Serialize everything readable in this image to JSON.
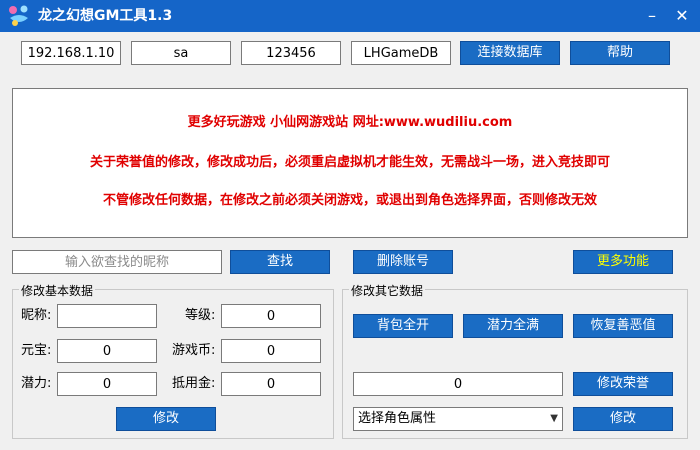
{
  "window": {
    "title": "龙之幻想GM工具1.3",
    "minimize": "–",
    "close": "✕"
  },
  "connection": {
    "ip": "192.168.1.10",
    "user": "sa",
    "password": "123456",
    "database": "LHGameDB",
    "connect_label": "连接数据库",
    "help_label": "帮助"
  },
  "notice": {
    "line1": "更多好玩游戏 小仙网游戏站 网址:www.wudiliu.com",
    "line2": "关于荣誉值的修改，修改成功后，必须重启虚拟机才能生效，无需战斗一场，进入竞技即可",
    "line3": "不管修改任何数据，在修改之前必须关闭游戏，或退出到角色选择界面，否则修改无效"
  },
  "search": {
    "placeholder": "输入欲查找的昵称",
    "search_label": "查找",
    "delete_label": "删除账号",
    "more_label": "更多功能"
  },
  "basic": {
    "title": "修改基本数据",
    "nickname_label": "昵称:",
    "nickname_value": "",
    "level_label": "等级:",
    "level_value": "0",
    "yuanbao_label": "元宝:",
    "yuanbao_value": "0",
    "coin_label": "游戏币:",
    "coin_value": "0",
    "potential_label": "潜力:",
    "potential_value": "0",
    "voucher_label": "抵用金:",
    "voucher_value": "0",
    "modify_label": "修改"
  },
  "other": {
    "title": "修改其它数据",
    "bag_label": "背包全开",
    "potential_full_label": "潜力全满",
    "restore_label": "恢复善恶值",
    "honor_value": "0",
    "honor_label": "修改荣誉",
    "attribute_select": "选择角色属性",
    "modify_label": "修改"
  },
  "colors": {
    "titlebar": "#1565c8",
    "button": "#1a6cc4",
    "notice_text": "#e00000",
    "more_text": "#ffff00"
  },
  "icons": {
    "app": "dragon-app-icon"
  }
}
